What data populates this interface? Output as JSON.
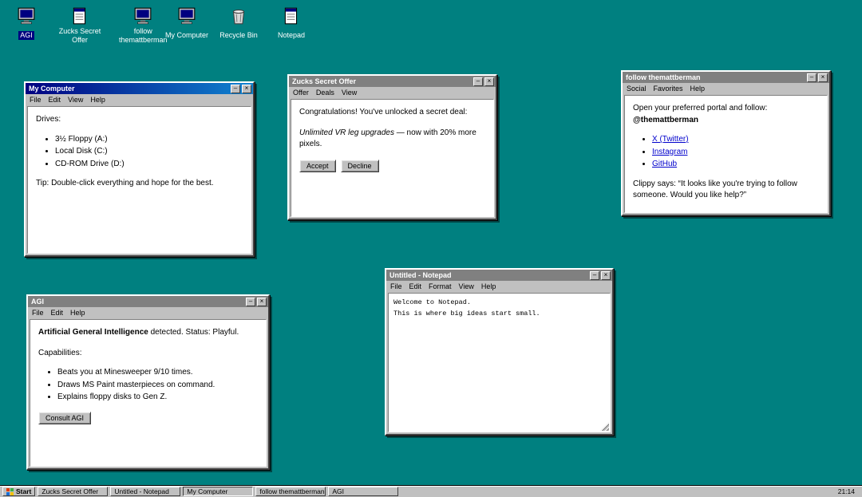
{
  "window_controls": {
    "minimize": "–",
    "close": "×"
  },
  "desktop_icons": [
    {
      "label": "AGI"
    },
    {
      "label": "Zucks Secret Offer"
    },
    {
      "label": "follow themattberman"
    },
    {
      "label": "My Computer"
    },
    {
      "label": "Recycle Bin"
    },
    {
      "label": "Notepad"
    }
  ],
  "windows": {
    "my_computer": {
      "title": "My Computer",
      "menu": [
        "File",
        "Edit",
        "View",
        "Help"
      ],
      "drives_heading": "Drives:",
      "drives": [
        "3½ Floppy (A:)",
        "Local Disk (C:)",
        "CD-ROM Drive (D:)"
      ],
      "tip": "Tip: Double-click everything and hope for the best."
    },
    "zucks": {
      "title": "Zucks Secret Offer",
      "menu": [
        "Offer",
        "Deals",
        "View"
      ],
      "congrats": "Congratulations! You've unlocked a secret deal:",
      "offer_italic": "Unlimited VR leg upgrades",
      "offer_rest": " — now with 20% more pixels.",
      "accept_label": "Accept",
      "decline_label": "Decline"
    },
    "follow": {
      "title": "follow themattberman",
      "menu": [
        "Social",
        "Favorites",
        "Help"
      ],
      "intro": "Open your preferred portal and follow:",
      "handle": "@themattberman",
      "links": [
        "X (Twitter)",
        "Instagram",
        "GitHub"
      ],
      "clippy": "Clippy says: “It looks like you're trying to follow someone. Would you like help?”"
    },
    "agi": {
      "title": "AGI",
      "menu": [
        "File",
        "Edit",
        "Help"
      ],
      "status_bold": "Artificial General Intelligence",
      "status_rest": " detected. Status: Playful.",
      "capabilities_heading": "Capabilities:",
      "capabilities": [
        "Beats you at Minesweeper 9/10 times.",
        "Draws MS Paint masterpieces on command.",
        "Explains floppy disks to Gen Z."
      ],
      "consult_label": "Consult AGI"
    },
    "notepad": {
      "title": "Untitled - Notepad",
      "menu": [
        "File",
        "Edit",
        "Format",
        "View",
        "Help"
      ],
      "text": "Welcome to Notepad.\nThis is where big ideas start small."
    }
  },
  "taskbar": {
    "start_label": "Start",
    "buttons": [
      "Zucks Secret Offer",
      "Untitled - Notepad",
      "My Computer",
      "follow themattberman",
      "AGI"
    ],
    "clock": "21:14"
  },
  "colors": {
    "desktop": "#008080",
    "title_active_start": "#000080",
    "title_active_end": "#1084d0",
    "title_inactive": "#808080",
    "chrome": "#c0c0c0",
    "link": "#0000cc"
  }
}
